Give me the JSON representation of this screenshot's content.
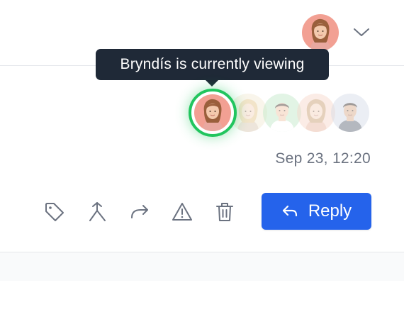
{
  "header": {
    "current_user_avatar": "avatar-woman-red-background",
    "menu_icon": "chevron-down-icon"
  },
  "tooltip": {
    "text": "Bryndís is currently viewing"
  },
  "viewers": [
    {
      "name": "Bryndís",
      "avatar": "woman-red-background",
      "active": true
    },
    {
      "avatar": "woman-blonde",
      "active": false
    },
    {
      "avatar": "man-green-background",
      "active": false
    },
    {
      "avatar": "woman-light-hair",
      "active": false
    },
    {
      "avatar": "man-dark-hair",
      "active": false
    }
  ],
  "message": {
    "timestamp": "Sep 23, 12:20"
  },
  "actions": {
    "tag_icon": "tag-icon",
    "merge_icon": "merge-icon",
    "forward_icon": "forward-arrow-icon",
    "spam_icon": "warning-triangle-icon",
    "delete_icon": "trash-icon",
    "reply_label": "Reply",
    "reply_icon": "reply-arrow-icon"
  },
  "colors": {
    "accent": "#2563eb",
    "active_ring": "#22c55e",
    "tooltip_bg": "#1f2937",
    "icon_gray": "#6b7280"
  }
}
